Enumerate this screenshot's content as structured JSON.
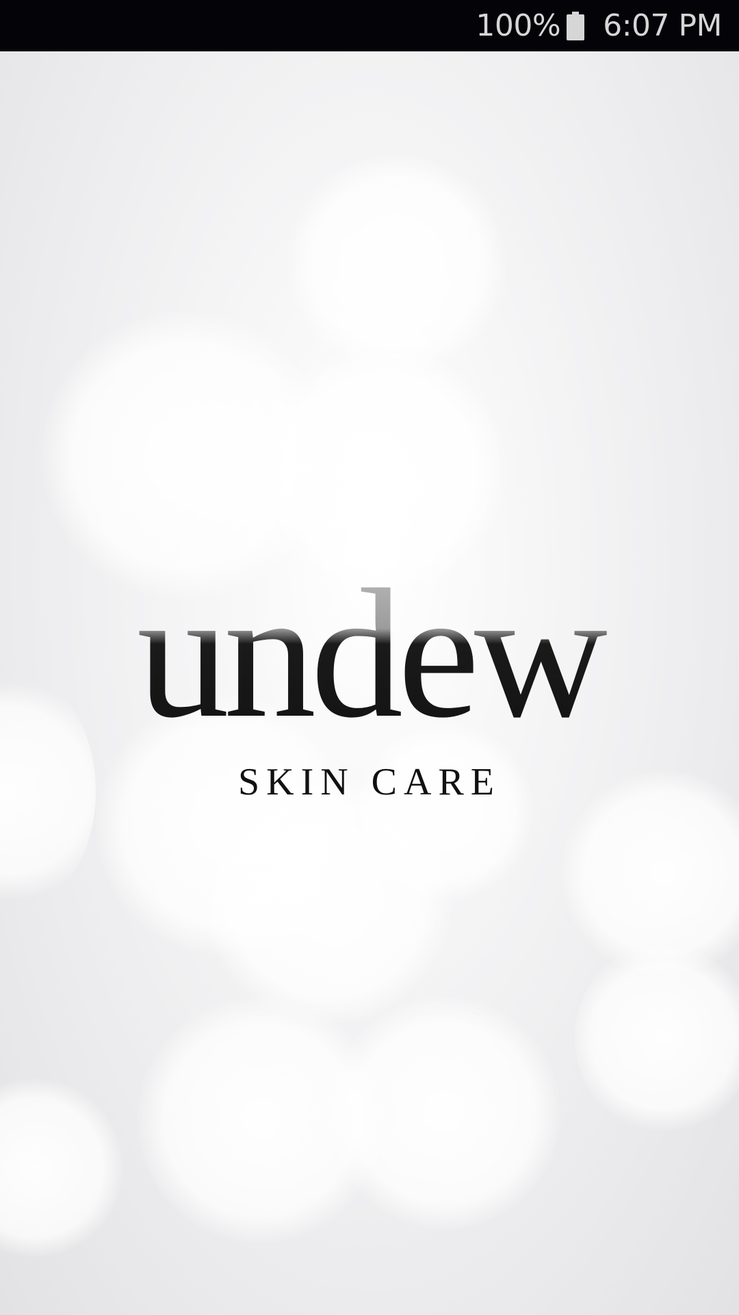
{
  "status_bar": {
    "battery_percent": "100%",
    "time": "6:07 PM",
    "battery_icon": "battery-full-icon"
  },
  "splash": {
    "brand_name": "undew",
    "tagline": "SKIN CARE"
  },
  "colors": {
    "status_bar_bg": "#040307",
    "status_text": "#d6d6d6",
    "logo_dark": "#111111",
    "logo_fade": "#a6a6a6"
  }
}
